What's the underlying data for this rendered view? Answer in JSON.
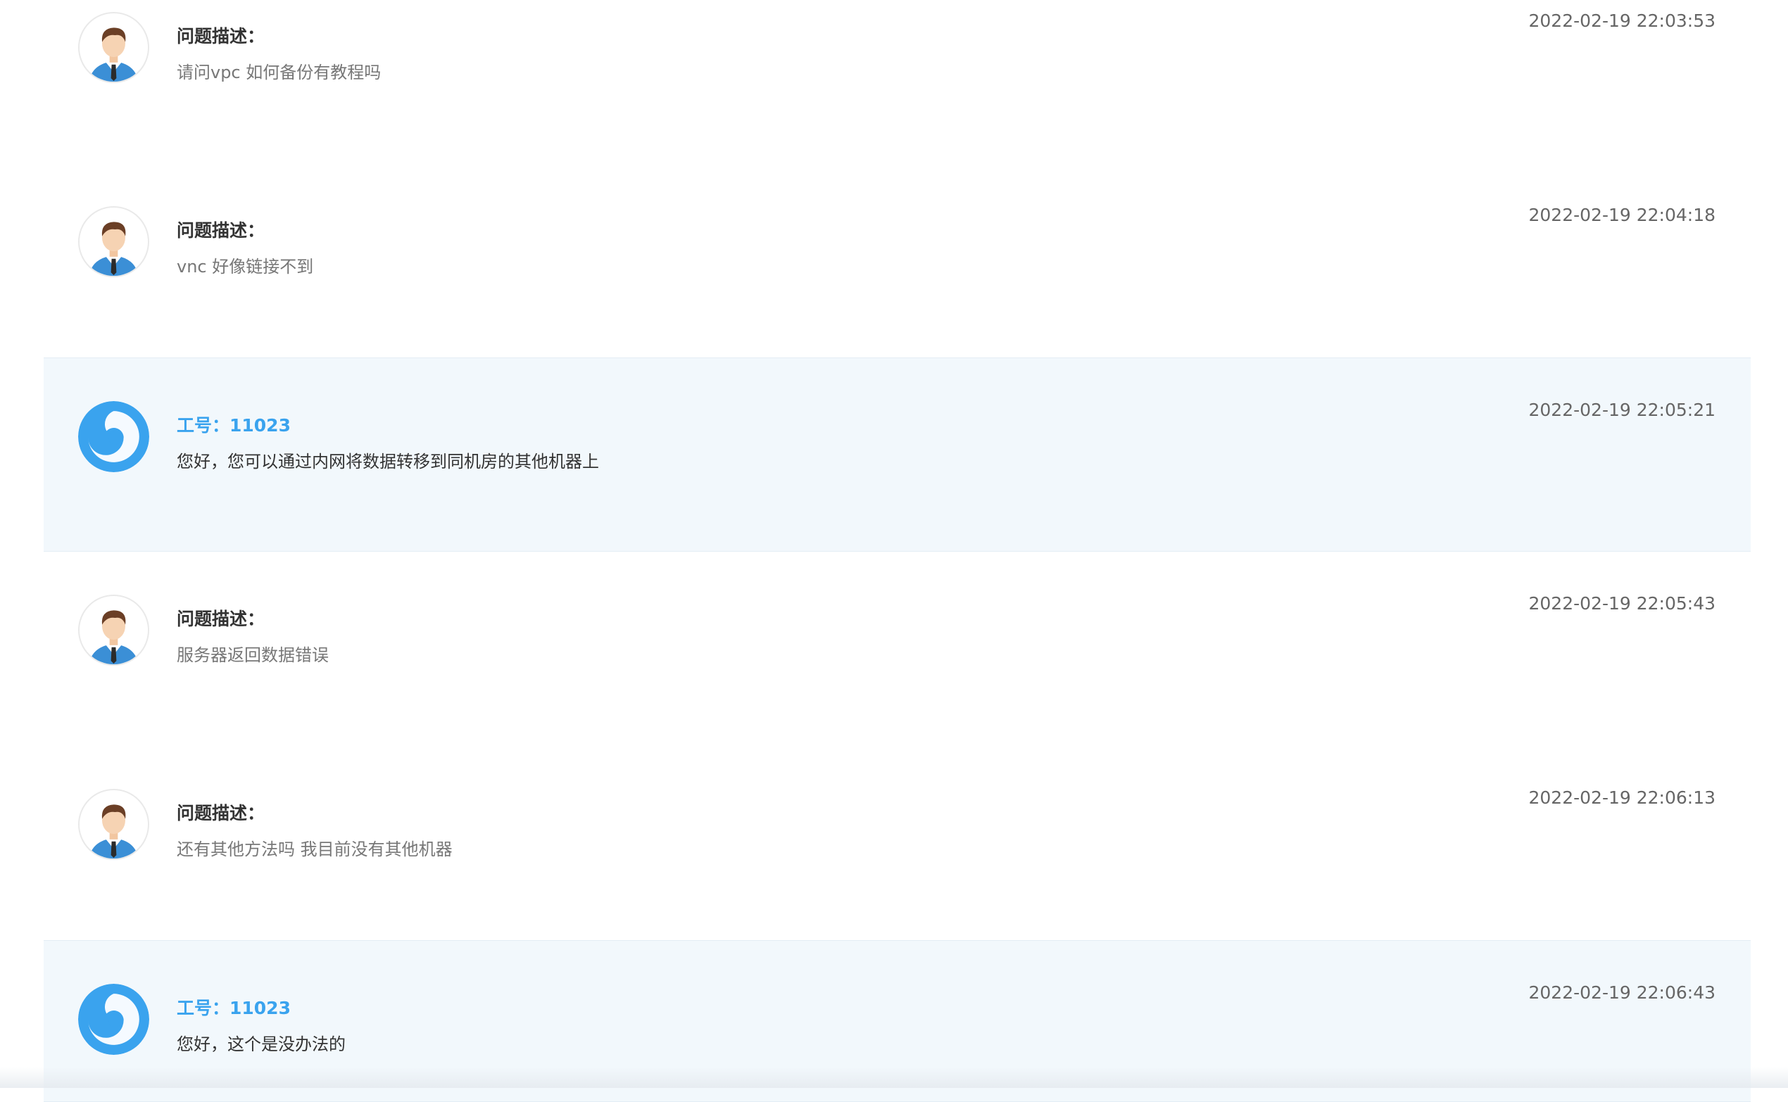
{
  "messages": [
    {
      "role": "user",
      "title": "问题描述：",
      "text": "请问vpc 如何备份有教程吗",
      "time": "2022-02-19 22:03:53"
    },
    {
      "role": "user",
      "title": "问题描述：",
      "text": "vnc 好像链接不到",
      "time": "2022-02-19 22:04:18"
    },
    {
      "role": "agent",
      "title": "工号：11023",
      "text": "您好，您可以通过内网将数据转移到同机房的其他机器上",
      "time": "2022-02-19 22:05:21"
    },
    {
      "role": "user",
      "title": "问题描述：",
      "text": "服务器返回数据错误",
      "time": "2022-02-19 22:05:43"
    },
    {
      "role": "user",
      "title": "问题描述：",
      "text": "还有其他方法吗 我目前没有其他机器",
      "time": "2022-02-19 22:06:13"
    },
    {
      "role": "agent",
      "title": "工号：11023",
      "text": "您好，这个是没办法的",
      "time": "2022-02-19 22:06:43"
    }
  ],
  "icons": {
    "user_avatar": "user-avatar-icon",
    "agent_avatar": "agent-logo-icon"
  },
  "colors": {
    "agent_accent": "#3aa3ee",
    "agent_row_bg": "#f2f8fc"
  }
}
